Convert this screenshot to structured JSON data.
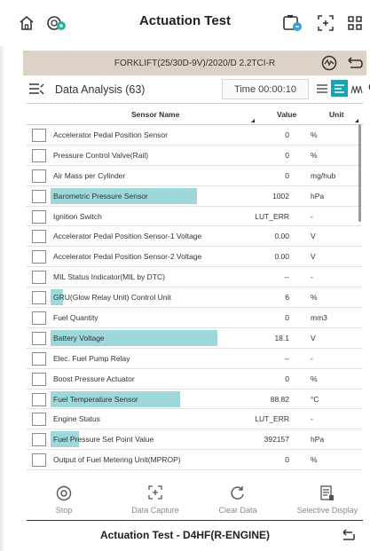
{
  "header": {
    "title": "Actuation Test",
    "icons": [
      "home-icon",
      "vci-connection-icon",
      "snapshot-icon",
      "capture-icon",
      "grid-icon"
    ]
  },
  "vehicle": {
    "text": "FORKLIFT(25/30D-9V)/2020/D 2.2TCI-R",
    "icons": [
      "steering-icon",
      "battery-icon",
      "back-icon"
    ]
  },
  "toolbar": {
    "label": "Data Analysis (63)",
    "time": "Time 00:00:10",
    "icons": [
      "list-view-icon",
      "text-view-icon",
      "graph-view-icon",
      "search-icon"
    ]
  },
  "table": {
    "headers": {
      "name": "Sensor Name",
      "value": "Value",
      "unit": "Unit"
    },
    "rows": [
      {
        "name": "Accelerator Pedal Position Sensor",
        "value": "0",
        "unit": "%",
        "highlight": 0
      },
      {
        "name": "Pressure Control Valve(Rail)",
        "value": "0",
        "unit": "%",
        "highlight": 0
      },
      {
        "name": "Air Mass per Cylinder",
        "value": "0",
        "unit": "mg/hub",
        "highlight": 0
      },
      {
        "name": "Barometric Pressure Sensor",
        "value": "1002",
        "unit": "hPa",
        "highlight": 0.71
      },
      {
        "name": "Ignition Switch",
        "value": "LUT_ERR",
        "unit": "-",
        "highlight": 0
      },
      {
        "name": "Accelerator Pedal Position Sensor-1 Voltage",
        "value": "0.00",
        "unit": "V",
        "highlight": 0
      },
      {
        "name": "Accelerator Pedal Position Sensor-2 Voltage",
        "value": "0.00",
        "unit": "V",
        "highlight": 0
      },
      {
        "name": "MIL Status Indicator(MIL by DTC)",
        "value": "--",
        "unit": "-",
        "highlight": 0
      },
      {
        "name": "GRU(Glow Relay Unit) Control Unit",
        "value": "6",
        "unit": "%",
        "highlight": 0.06
      },
      {
        "name": "Fuel Quantity",
        "value": "0",
        "unit": "mm3",
        "highlight": 0
      },
      {
        "name": "Battery Voltage",
        "value": "18.1",
        "unit": "V",
        "highlight": 0.81
      },
      {
        "name": "Elec. Fuel Pump Relay",
        "value": "--",
        "unit": "-",
        "highlight": 0
      },
      {
        "name": "Boost Pressure Actuator",
        "value": "0",
        "unit": "%",
        "highlight": 0
      },
      {
        "name": "Fuel Temperature Sensor",
        "value": "88.82",
        "unit": "°C",
        "highlight": 0.63
      },
      {
        "name": "Engine Status",
        "value": "LUT_ERR",
        "unit": "-",
        "highlight": 0
      },
      {
        "name": "Fuel Pressure Set Point Value",
        "value": "392157",
        "unit": "hPa",
        "highlight": 0.14
      },
      {
        "name": "Output of Fuel Metering Unit(MPROP)",
        "value": "0",
        "unit": "%",
        "highlight": 0
      }
    ]
  },
  "bottom": {
    "stop": "Stop",
    "capture": "Data Capture",
    "clear": "Clear Data",
    "selective": "Selective Display"
  },
  "footer": {
    "title": "Actuation Test  - D4HF(R-ENGINE)"
  },
  "colors": {
    "highlight": "#9fd8db",
    "vehicle_bar": "#ddd2c6",
    "active_view": "#1aa3b0"
  }
}
